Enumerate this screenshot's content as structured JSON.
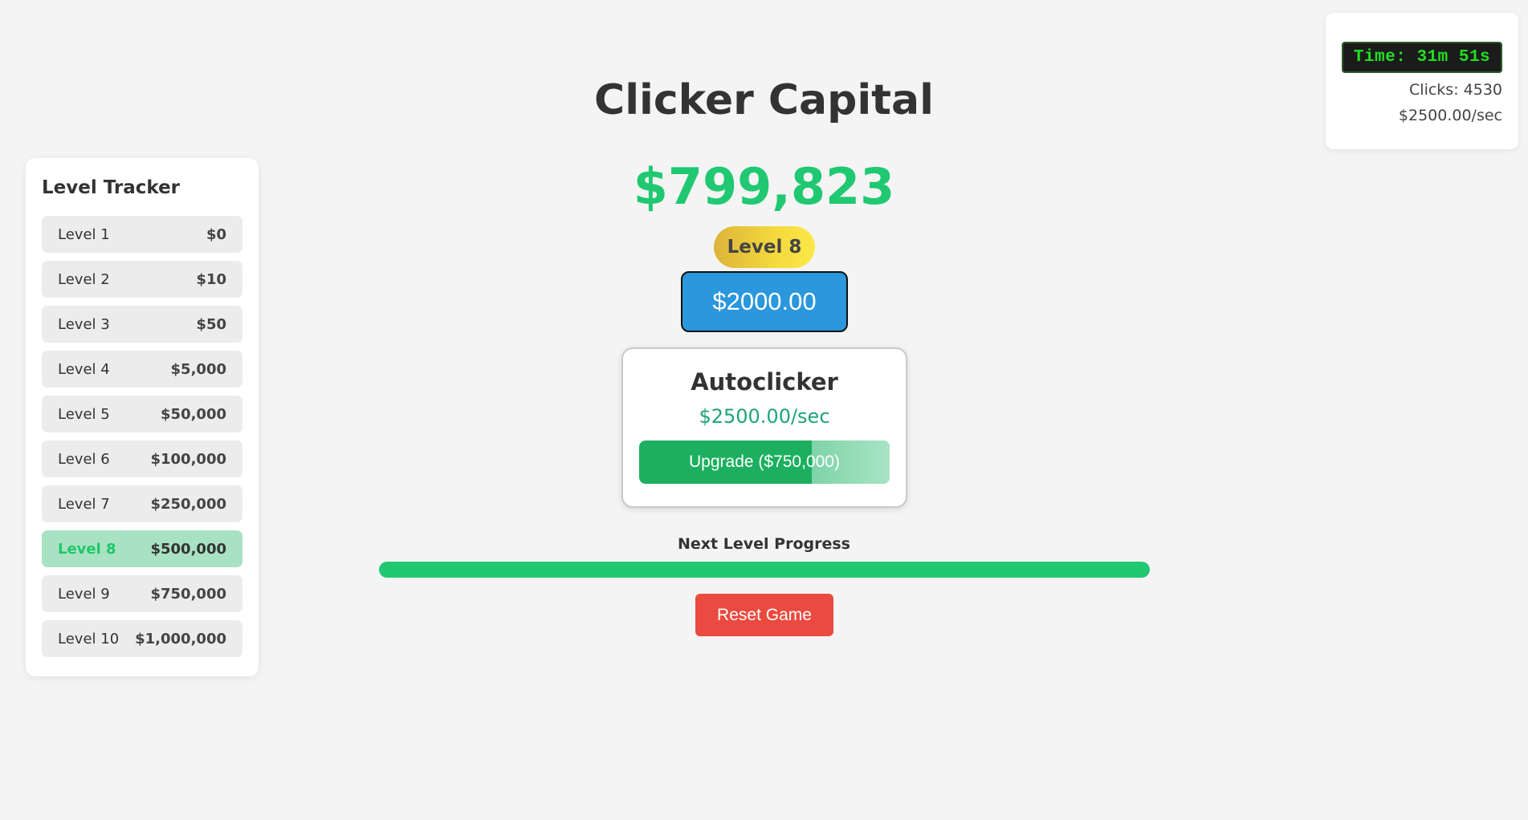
{
  "app": {
    "title": "Clicker Capital"
  },
  "stats": {
    "timer": "Time: 31m 51s",
    "clicks": "Clicks: 4530",
    "rate": "$2500.00/sec"
  },
  "tracker": {
    "title": "Level Tracker",
    "levels": [
      {
        "name": "Level 1",
        "cost": "$0"
      },
      {
        "name": "Level 2",
        "cost": "$10"
      },
      {
        "name": "Level 3",
        "cost": "$50"
      },
      {
        "name": "Level 4",
        "cost": "$5,000"
      },
      {
        "name": "Level 5",
        "cost": "$50,000"
      },
      {
        "name": "Level 6",
        "cost": "$100,000"
      },
      {
        "name": "Level 7",
        "cost": "$250,000"
      },
      {
        "name": "Level 8",
        "cost": "$500,000",
        "active": true
      },
      {
        "name": "Level 9",
        "cost": "$750,000"
      },
      {
        "name": "Level 10",
        "cost": "$1,000,000"
      }
    ]
  },
  "main": {
    "money": "$799,823",
    "level_badge": "Level 8",
    "click_value": "$2000.00"
  },
  "autoclicker": {
    "title": "Autoclicker",
    "rate": "$2500.00/sec",
    "upgrade_label": "Upgrade ($750,000)",
    "affordability_progress": 0.69
  },
  "progress": {
    "label": "Next Level Progress",
    "value": 1.0
  },
  "reset": {
    "label": "Reset Game"
  },
  "colors": {
    "accent_green": "#20c872",
    "click_blue": "#2b97dc",
    "reset_red": "#ea4a3f",
    "badge_gold": "#f4d93c",
    "timer_green": "#21e021"
  }
}
